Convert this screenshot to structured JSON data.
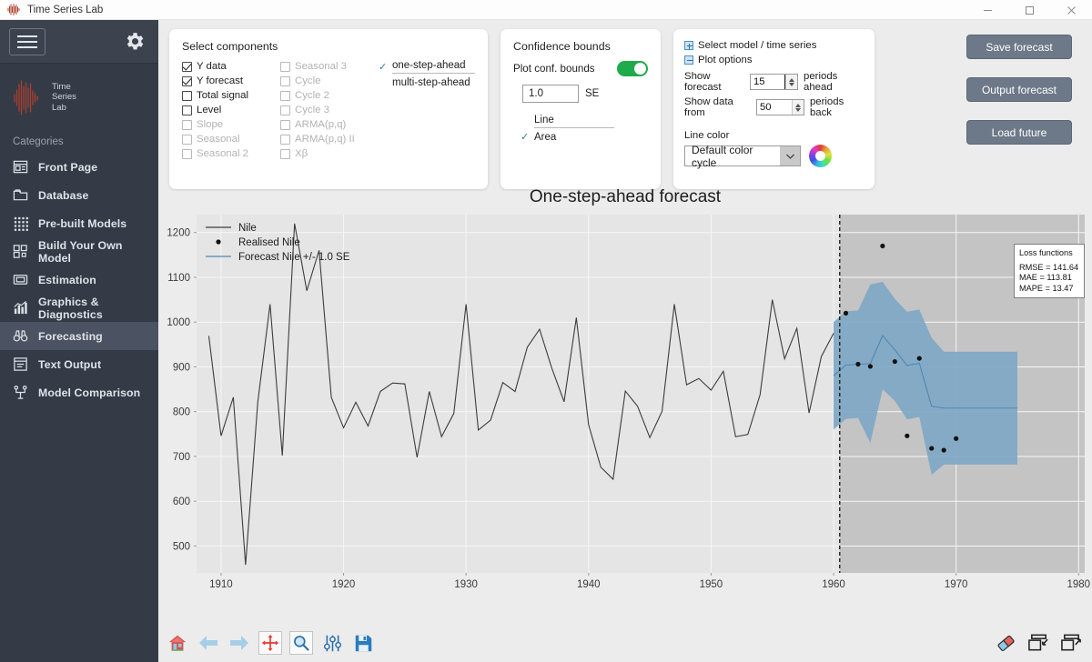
{
  "window": {
    "title": "Time Series Lab",
    "minimize_label": "–",
    "maximize_label": "☐",
    "close_label": "✕"
  },
  "sidebar": {
    "logo_text": "Time\nSeries\nLab",
    "logo_line1": "Time",
    "logo_line2": "Series",
    "logo_line3": "Lab",
    "categories_label": "Categories",
    "items": [
      {
        "label": "Front Page",
        "icon": "front-page-icon",
        "active": false
      },
      {
        "label": "Database",
        "icon": "database-icon",
        "active": false
      },
      {
        "label": "Pre-built Models",
        "icon": "grid-dots-icon",
        "active": false
      },
      {
        "label": "Build Your Own Model",
        "icon": "blocks-icon",
        "active": false
      },
      {
        "label": "Estimation",
        "icon": "chip-icon",
        "active": false
      },
      {
        "label": "Graphics & Diagnostics",
        "icon": "bar-chart-icon",
        "active": false
      },
      {
        "label": "Forecasting",
        "icon": "binoculars-icon",
        "active": true
      },
      {
        "label": "Text Output",
        "icon": "text-output-icon",
        "active": false
      },
      {
        "label": "Model Comparison",
        "icon": "compare-icon",
        "active": false
      }
    ]
  },
  "components_panel": {
    "title": "Select components",
    "column1": [
      {
        "label": "Y data",
        "checked": true,
        "enabled": true
      },
      {
        "label": "Y forecast",
        "checked": true,
        "enabled": true
      },
      {
        "label": "Total signal",
        "checked": false,
        "enabled": true
      },
      {
        "label": "Level",
        "checked": false,
        "enabled": true
      },
      {
        "label": "Slope",
        "checked": false,
        "enabled": false
      },
      {
        "label": "Seasonal",
        "checked": false,
        "enabled": false
      },
      {
        "label": "Seasonal 2",
        "checked": false,
        "enabled": false
      }
    ],
    "column2": [
      {
        "label": "Seasonal 3",
        "checked": false,
        "enabled": false
      },
      {
        "label": "Cycle",
        "checked": false,
        "enabled": false
      },
      {
        "label": "Cycle 2",
        "checked": false,
        "enabled": false
      },
      {
        "label": "Cycle 3",
        "checked": false,
        "enabled": false
      },
      {
        "label": "ARMA(p,q)",
        "checked": false,
        "enabled": false
      },
      {
        "label": "ARMA(p,q) II",
        "checked": false,
        "enabled": false
      },
      {
        "label": "Xβ",
        "checked": false,
        "enabled": false
      }
    ],
    "step_options": [
      {
        "label": "one-step-ahead",
        "selected": true
      },
      {
        "label": "multi-step-ahead",
        "selected": false
      }
    ],
    "check_glyph": "✓"
  },
  "confidence_panel": {
    "title": "Confidence bounds",
    "plot_bounds_label": "Plot conf. bounds",
    "plot_bounds_on": true,
    "se_value": "1.0",
    "se_unit": "SE",
    "bound_styles": [
      {
        "label": "Line",
        "selected": false
      },
      {
        "label": "Area",
        "selected": true
      }
    ],
    "check_glyph": "✓"
  },
  "model_panel": {
    "tree_items": [
      {
        "label": "Select model / time series",
        "expandable": true
      },
      {
        "label": "Plot options",
        "expandable": false
      }
    ],
    "forecast_label": "Show forecast",
    "forecast_value": "15",
    "forecast_suffix": "periods ahead",
    "databack_label": "Show data from",
    "databack_value": "50",
    "databack_suffix": "periods back",
    "line_color_label": "Line color",
    "line_color_value": "Default color cycle",
    "color_wheel_icon": "color-wheel-icon"
  },
  "action_buttons": [
    {
      "label": "Save forecast"
    },
    {
      "label": "Output forecast"
    },
    {
      "label": "Load future"
    }
  ],
  "loss_functions": {
    "title": "Loss functions",
    "rows": [
      "RMSE = 141.64",
      "MAE = 113.81",
      "MAPE = 13.47"
    ]
  },
  "toolbar": {
    "left": [
      {
        "name": "home-icon",
        "label": "Home"
      },
      {
        "name": "back-arrow-icon",
        "label": "Back"
      },
      {
        "name": "forward-arrow-icon",
        "label": "Forward"
      },
      {
        "name": "pan-icon",
        "label": "Pan"
      },
      {
        "name": "zoom-icon",
        "label": "Zoom"
      },
      {
        "name": "sliders-icon",
        "label": "Configure subplots"
      },
      {
        "name": "save-disk-icon",
        "label": "Save figure"
      }
    ],
    "right": [
      {
        "name": "eraser-icon",
        "label": "Clear"
      },
      {
        "name": "window-shrink-icon",
        "label": "Shrink window"
      },
      {
        "name": "window-expand-icon",
        "label": "Expand window"
      }
    ]
  },
  "chart_data": {
    "type": "line",
    "title": "One-step-ahead forecast",
    "xlabel": "",
    "ylabel": "",
    "xlim": [
      1908.0,
      1980.5
    ],
    "ylim": [
      440,
      1240
    ],
    "xticks": [
      1910,
      1920,
      1930,
      1940,
      1950,
      1960,
      1970,
      1980
    ],
    "yticks": [
      500,
      600,
      700,
      800,
      900,
      1000,
      1100,
      1200
    ],
    "grid": true,
    "legend_position": "upper left",
    "legend": [
      {
        "label": "Nile",
        "style": "line",
        "color": "#3c3c3c"
      },
      {
        "label": "Realised Nile",
        "style": "marker",
        "color": "#111111"
      },
      {
        "label": "Forecast Nile +/- 1.0 SE",
        "style": "line",
        "color": "#4f87b5"
      }
    ],
    "forecast_start": 1961,
    "forecast_shade_color": "#b0b0b0",
    "conf_band_color": "#7ea7c4",
    "series": [
      {
        "name": "Nile",
        "color": "#3c3c3c",
        "x": [
          1909,
          1910,
          1911,
          1912,
          1913,
          1914,
          1915,
          1916,
          1917,
          1918,
          1919,
          1920,
          1921,
          1922,
          1923,
          1924,
          1925,
          1926,
          1927,
          1928,
          1929,
          1930,
          1931,
          1932,
          1933,
          1934,
          1935,
          1936,
          1937,
          1938,
          1939,
          1940,
          1941,
          1942,
          1943,
          1944,
          1945,
          1946,
          1947,
          1948,
          1949,
          1950,
          1951,
          1952,
          1953,
          1954,
          1955,
          1956,
          1957,
          1958,
          1959,
          1960
        ],
        "y": [
          969,
          746,
          832,
          458,
          822,
          1040,
          702,
          1220,
          1070,
          1160,
          832,
          764,
          821,
          768,
          845,
          864,
          862,
          698,
          845,
          744,
          796,
          1040,
          759,
          781,
          865,
          845,
          944,
          984,
          897,
          822,
          1010,
          771,
          676,
          649,
          846,
          812,
          742,
          801,
          1040,
          860,
          874,
          848,
          890,
          744,
          749,
          838,
          1050,
          918,
          986,
          797,
          923,
          975
        ]
      },
      {
        "name": "Realised Nile",
        "color": "#111111",
        "style": "scatter",
        "x": [
          1961,
          1962,
          1963,
          1964,
          1965,
          1966,
          1967,
          1968,
          1969,
          1970
        ],
        "y": [
          1020,
          906,
          901,
          1170,
          912,
          746,
          919,
          718,
          714,
          740
        ]
      },
      {
        "name": "Forecast Nile",
        "color": "#4f87b5",
        "x": [
          1960,
          1961,
          1962,
          1963,
          1964,
          1965,
          1966,
          1967,
          1968,
          1969,
          1970,
          1971,
          1972,
          1973,
          1974,
          1975
        ],
        "y": [
          880,
          904,
          906,
          907,
          970,
          938,
          903,
          908,
          812,
          808,
          808,
          808,
          808,
          808,
          808,
          808
        ]
      },
      {
        "name": "Conf upper (+1 SE)",
        "color": "#7ea7c4",
        "x": [
          1960,
          1961,
          1962,
          1963,
          1964,
          1965,
          1966,
          1967,
          1968,
          1969,
          1970,
          1971,
          1972,
          1973,
          1974,
          1975
        ],
        "y": [
          1000,
          1024,
          1026,
          1084,
          1090,
          1052,
          1023,
          1028,
          965,
          934,
          934,
          934,
          934,
          934,
          934,
          934
        ]
      },
      {
        "name": "Conf lower (-1 SE)",
        "color": "#7ea7c4",
        "x": [
          1960,
          1961,
          1962,
          1963,
          1964,
          1965,
          1966,
          1967,
          1968,
          1969,
          1970,
          1971,
          1972,
          1973,
          1974,
          1975
        ],
        "y": [
          760,
          784,
          786,
          730,
          850,
          824,
          783,
          788,
          659,
          682,
          682,
          682,
          682,
          682,
          682,
          682
        ]
      }
    ]
  }
}
